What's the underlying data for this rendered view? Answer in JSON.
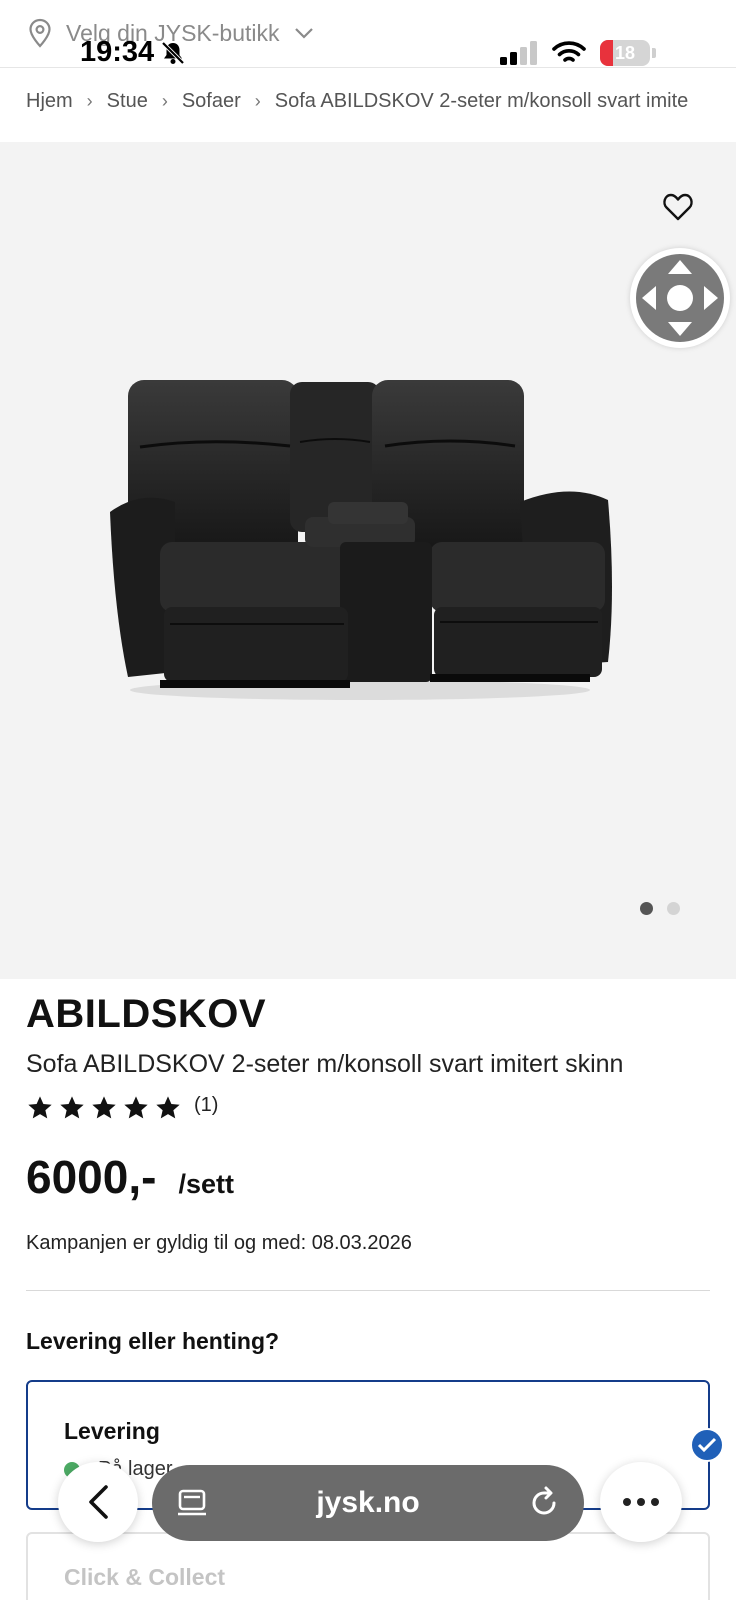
{
  "status_bar": {
    "time": "19:34",
    "battery": "18"
  },
  "store_selector": {
    "label": "Velg din JYSK-butikk"
  },
  "breadcrumb": {
    "items": [
      "Hjem",
      "Stue",
      "Sofaer",
      "Sofa ABILDSKOV 2-seter m/konsoll svart imite"
    ]
  },
  "gallery": {
    "image_count": 2,
    "active_index": 0
  },
  "product": {
    "brand": "ABILDSKOV",
    "name": "Sofa ABILDSKOV 2-seter m/konsoll svart imitert skinn",
    "rating_stars": 5,
    "review_count": "(1)",
    "price": "6000,-",
    "unit": "/sett",
    "campaign": "Kampanjen er gyldig til og med: 08.03.2026"
  },
  "delivery": {
    "heading": "Levering eller henting?",
    "options": [
      {
        "title": "Levering",
        "stock": "På lager",
        "selected": true
      },
      {
        "title": "Click & Collect",
        "selected": false
      }
    ]
  },
  "browser": {
    "url": "jysk.no"
  },
  "colors": {
    "selected_border": "#143c8a",
    "check_badge": "#2060b8",
    "in_stock": "#4caa64",
    "battery_low": "#e8323c"
  }
}
